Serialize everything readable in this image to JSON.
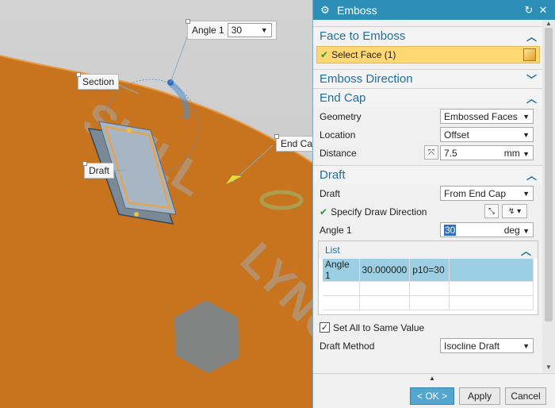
{
  "viewport": {
    "labels": {
      "angle_label": "Angle 1",
      "angle_value": "30",
      "section": "Section",
      "end_cap": "End Ca",
      "draft": "Draft"
    },
    "watermark": "SKILL LYNC"
  },
  "dialog": {
    "title": "Emboss",
    "sections": {
      "face": {
        "title": "Face to Emboss",
        "select_label": "Select Face (1)"
      },
      "direction": {
        "title": "Emboss Direction"
      },
      "endcap": {
        "title": "End Cap",
        "geometry_label": "Geometry",
        "geometry_value": "Embossed Faces",
        "location_label": "Location",
        "location_value": "Offset",
        "distance_label": "Distance",
        "distance_value": "7.5",
        "distance_unit": "mm"
      },
      "draft": {
        "title": "Draft",
        "draft_label": "Draft",
        "draft_value": "From End Cap",
        "specify_label": "Specify Draw Direction",
        "angle_label": "Angle 1",
        "angle_value": "30",
        "angle_unit": "deg",
        "list_title": "List",
        "list_rows": [
          [
            "Angle 1",
            "30.000000",
            "p10=30"
          ]
        ],
        "same_value_label": "Set All to Same Value",
        "method_label": "Draft Method",
        "method_value": "Isocline Draft"
      }
    },
    "buttons": {
      "ok": "< OK >",
      "apply": "Apply",
      "cancel": "Cancel"
    },
    "colors": {
      "title_bar": "#2d8fb7",
      "section_title": "#1f6f9c",
      "selection_highlight": "#ffd874"
    }
  }
}
